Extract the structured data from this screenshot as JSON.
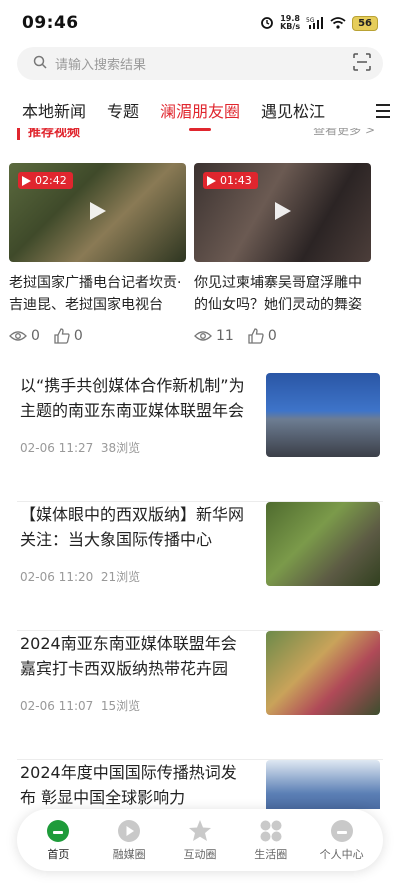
{
  "status": {
    "time": "09:46",
    "speed_value": "19.8",
    "speed_unit": "KB/s",
    "network": "5G",
    "battery": "56"
  },
  "search": {
    "placeholder": "请输入搜索结果"
  },
  "tabs": [
    {
      "label": "本地新闻",
      "active": false
    },
    {
      "label": "专题",
      "active": false
    },
    {
      "label": "澜湄朋友圈",
      "active": true
    },
    {
      "label": "遇见松江",
      "active": false
    }
  ],
  "section": {
    "title": "推荐视频",
    "more": "查看更多 >"
  },
  "videos": [
    {
      "duration": "02:42",
      "title": "老挝国家广播电台记者坎贡·吉迪昆、老挝国家电视台",
      "views": "0",
      "likes": "0"
    },
    {
      "duration": "01:43",
      "title": "你见过柬埔寨吴哥窟浮雕中的仙女吗？她们灵动的舞姿",
      "views": "11",
      "likes": "0"
    }
  ],
  "news": [
    {
      "title": "以“携手共创媒体合作新机制”为主题的南亚东南亚媒体联盟年会",
      "time": "02-06 11:27",
      "views": "38浏览"
    },
    {
      "title": "【媒体眼中的西双版纳】新华网关注：当大象国际传播中心",
      "time": "02-06 11:20",
      "views": "21浏览"
    },
    {
      "title": "2024南亚东南亚媒体联盟年会嘉宾打卡西双版纳热带花卉园",
      "time": "02-06 11:07",
      "views": "15浏览"
    },
    {
      "title": "2024年度中国国际传播热词发布 彰显中国全球影响力",
      "time": "",
      "views": ""
    }
  ],
  "bottom_nav": [
    {
      "label": "首页",
      "icon": "home-icon",
      "active": true
    },
    {
      "label": "融媒圈",
      "icon": "play-circle-icon",
      "active": false
    },
    {
      "label": "互动圈",
      "icon": "star-icon",
      "active": false
    },
    {
      "label": "生活圈",
      "icon": "grid-icon",
      "active": false
    },
    {
      "label": "个人中心",
      "icon": "user-icon",
      "active": false
    }
  ],
  "colors": {
    "accent": "#e0262e",
    "home_icon": "#1e9b3a"
  }
}
